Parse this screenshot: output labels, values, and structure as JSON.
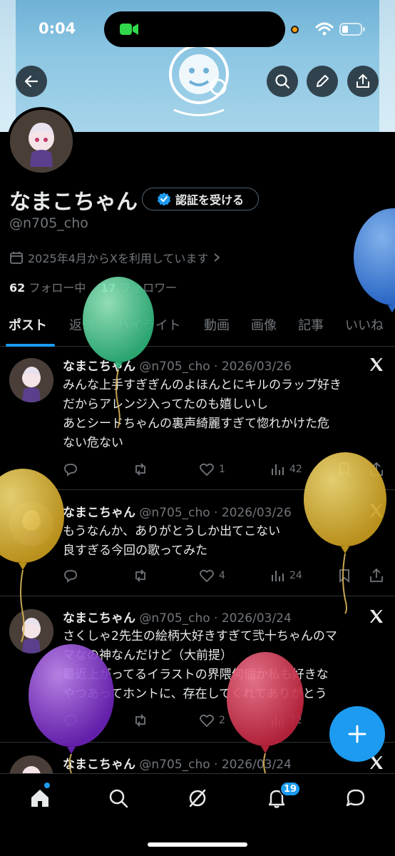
{
  "status": {
    "time": "0:04"
  },
  "profile": {
    "name": "なまこちゃん",
    "verify_label": "認証を受ける",
    "handle": "@n705_cho",
    "joined": "2025年4月からXを利用しています",
    "following_count": "62",
    "following_label": "フォロー中",
    "followers_count": "17",
    "followers_label": "フォロワー"
  },
  "tabs": [
    {
      "label": "ポスト"
    },
    {
      "label": "返信"
    },
    {
      "label": "ハイライト"
    },
    {
      "label": "動画"
    },
    {
      "label": "画像"
    },
    {
      "label": "記事"
    },
    {
      "label": "いいね"
    }
  ],
  "posts": [
    {
      "name": "なまこちゃん",
      "meta": "@n705_cho · 2026/03/26",
      "lines": [
        "みんな上手すぎぎんのよほんとにキルのラップ好き",
        "だからアレンジ入ってたのも嬉しいし",
        "あとシードちゃんの裏声綺麗すぎて惚れかけた危",
        "ない危ない"
      ],
      "likes": "1",
      "views": "42"
    },
    {
      "name": "なまこちゃん",
      "meta": "@n705_cho · 2026/03/26",
      "lines": [
        "もうなんか、ありがとうしか出てこない",
        "良すぎる今回の歌ってみた"
      ],
      "likes": "4",
      "views": "24"
    },
    {
      "name": "なまこちゃん",
      "meta": "@n705_cho · 2026/03/24",
      "lines": [
        "さくしゃ2先生の絵柄大好きすぎて弐十ちゃんのマ",
        "マなの神なんだけど（大前提）",
        "最近上がってるイラストの界隈何個か私も好きな",
        "やつあってホントに、存在してくれてありがとう"
      ],
      "likes": "2",
      "views": "72"
    },
    {
      "name": "なまこちゃん",
      "meta": "@n705_cho · 2026/03/24"
    }
  ],
  "nav": {
    "notification_badge": "19"
  },
  "colors": {
    "accent": "#1d9bf0",
    "background": "#000000",
    "muted": "#71767b"
  }
}
